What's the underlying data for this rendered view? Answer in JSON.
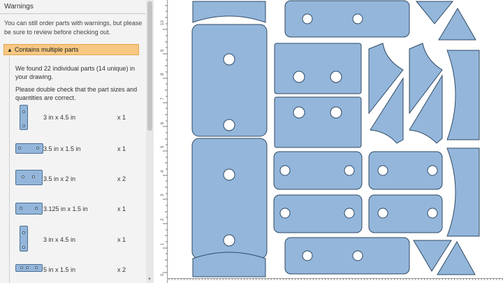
{
  "panel": {
    "title": "Warnings",
    "warning_text": "You can still order parts with warnings, but please be sure to review before checking out.",
    "warning_header": "Contains multiple parts",
    "warning_toggle_icon": "▲",
    "found_text": "We found 22 individual parts (14 unique) in your drawing.",
    "check_text": "Please double check that the part sizes and quantities are correct.",
    "parts": [
      {
        "size": "3 in x 4.5 in",
        "qty": "x 1"
      },
      {
        "size": "3.5 in x 1.5 in",
        "qty": "x 1"
      },
      {
        "size": "3.5 in x 2 in",
        "qty": "x 2"
      },
      {
        "size": "3.125 in x 1.5 in",
        "qty": "x 1"
      },
      {
        "size": "3 in x 4.5 in",
        "qty": "x 1"
      },
      {
        "size": "5 in x 1.5 in",
        "qty": "x 2"
      }
    ]
  },
  "ruler": {
    "labels": [
      "10",
      "9",
      "8",
      "7",
      "6",
      "5",
      "4",
      "3",
      "2",
      "1",
      "0"
    ]
  },
  "colors": {
    "part_fill": "#93b6da",
    "part_stroke": "#3d5873",
    "warning_bg": "#f6c882"
  }
}
